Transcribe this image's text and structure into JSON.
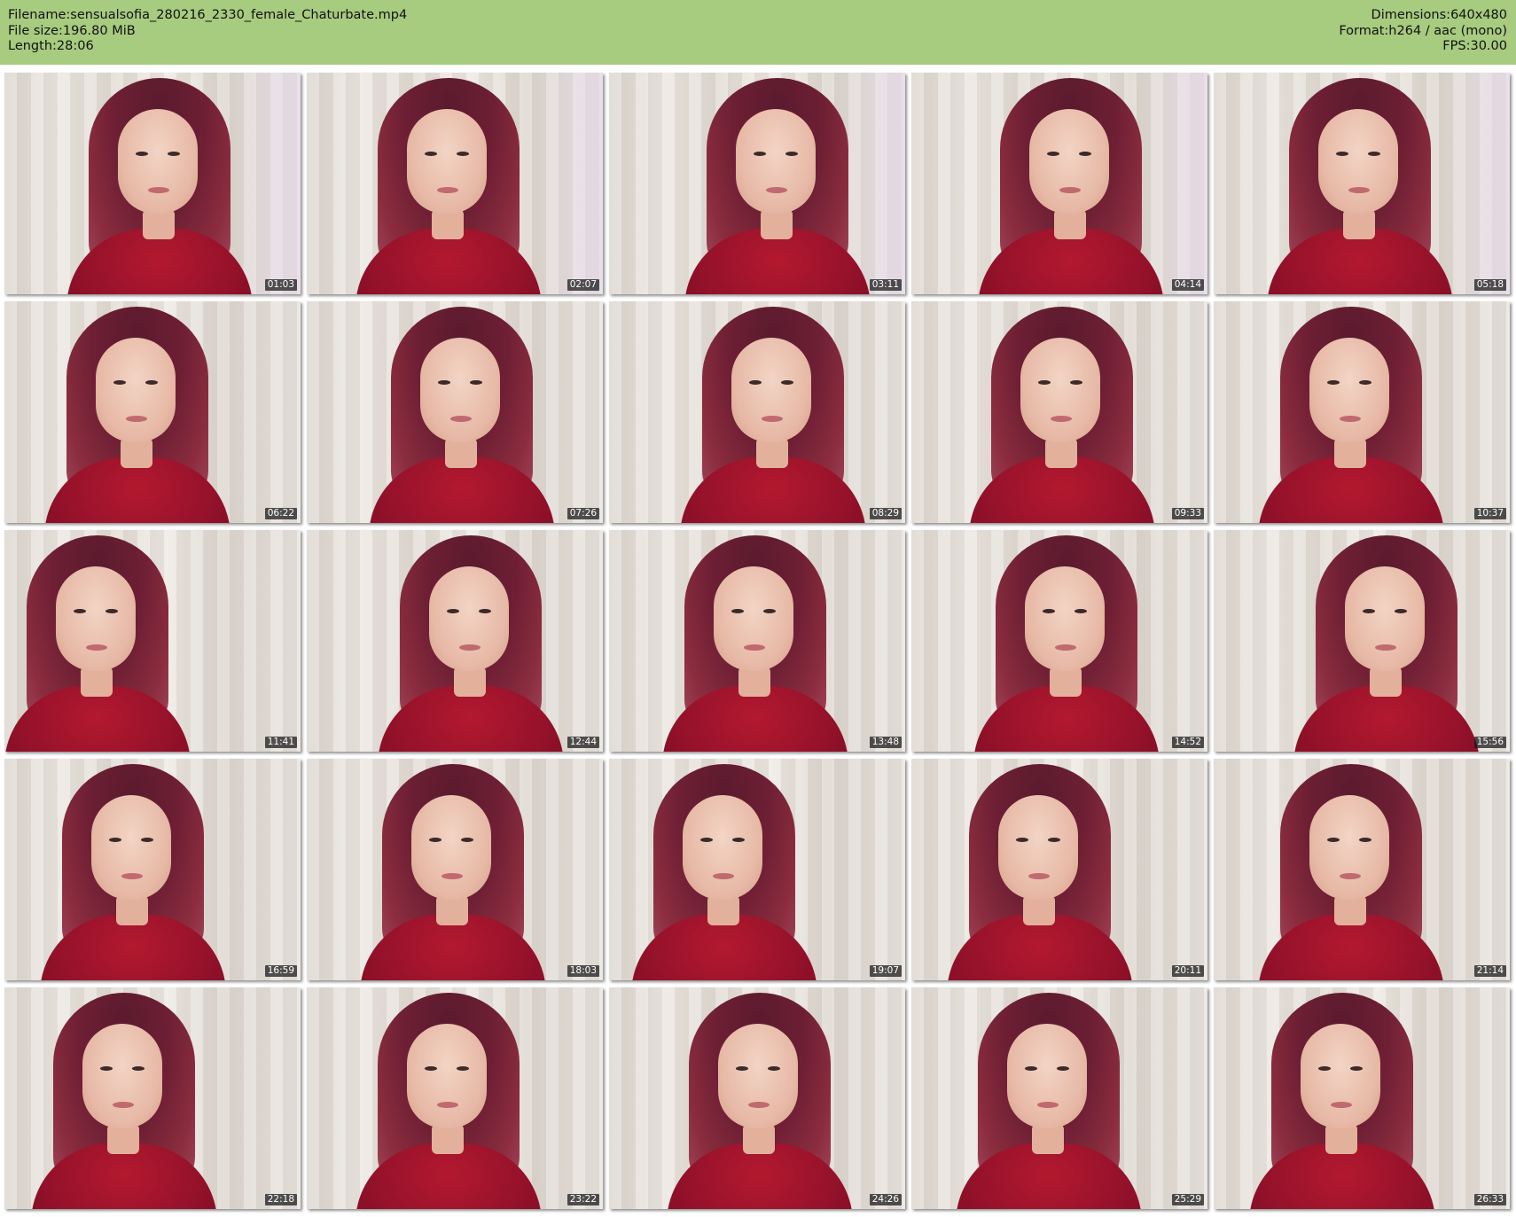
{
  "header": {
    "left": [
      {
        "label": "Filename:",
        "value": "sensualsofia_280216_2330_female_Chaturbate.mp4"
      },
      {
        "label": "File size:",
        "value": "196.80 MiB"
      },
      {
        "label": "Length:",
        "value": "28:06"
      }
    ],
    "right": [
      {
        "label": "Dimensions:",
        "value": "640x480"
      },
      {
        "label": "Format:",
        "value": "h264 / aac (mono)"
      },
      {
        "label": "FPS:",
        "value": "30.00"
      }
    ]
  },
  "thumbnails": [
    {
      "time": "01:03"
    },
    {
      "time": "02:07"
    },
    {
      "time": "03:11"
    },
    {
      "time": "04:14"
    },
    {
      "time": "05:18"
    },
    {
      "time": "06:22"
    },
    {
      "time": "07:26"
    },
    {
      "time": "08:29"
    },
    {
      "time": "09:33"
    },
    {
      "time": "10:37"
    },
    {
      "time": "11:41"
    },
    {
      "time": "12:44"
    },
    {
      "time": "13:48"
    },
    {
      "time": "14:52"
    },
    {
      "time": "15:56"
    },
    {
      "time": "16:59"
    },
    {
      "time": "18:03"
    },
    {
      "time": "19:07"
    },
    {
      "time": "20:11"
    },
    {
      "time": "21:14"
    },
    {
      "time": "22:18"
    },
    {
      "time": "23:22"
    },
    {
      "time": "24:26"
    },
    {
      "time": "25:29"
    },
    {
      "time": "26:33"
    }
  ],
  "colors": {
    "header_bg": "#a7cb7f",
    "page_bg": "#ffffff",
    "timestamp_bg": "#141414"
  }
}
